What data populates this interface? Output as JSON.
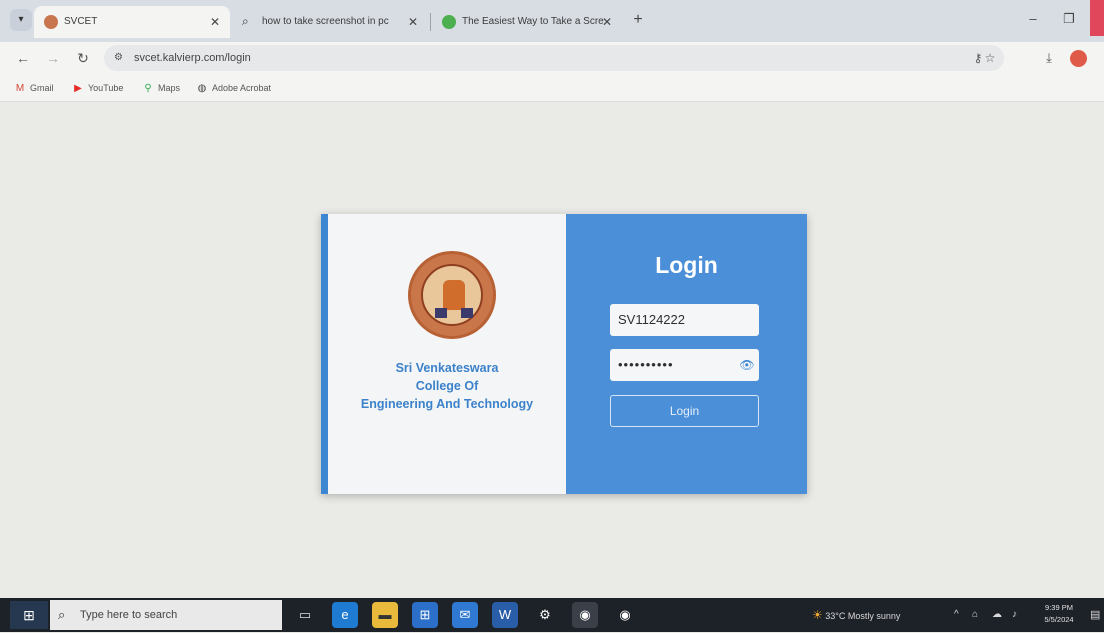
{
  "browser": {
    "tabs": [
      {
        "title": "SVCET",
        "active": true
      },
      {
        "title": "how to take screenshot in pc",
        "active": false
      },
      {
        "title": "The Easiest Way to Take a Scre",
        "active": false
      }
    ],
    "url": "svcet.kalvierp.com/login",
    "bookmarks": [
      "Gmail",
      "YouTube",
      "Maps",
      "Adobe Acrobat"
    ]
  },
  "login_card": {
    "college_name": [
      "Sri Venkateswara",
      "College Of",
      "Engineering And Technology"
    ],
    "title": "Login",
    "username_value": "SV1124222",
    "password_value": "••••••••••",
    "login_button": "Login",
    "accent_color": "#4b8fd8"
  },
  "taskbar": {
    "search_placeholder": "Type here to search",
    "weather_temp": "33°C",
    "weather_text": "Mostly sunny",
    "time": "9:39 PM",
    "date": "5/5/2024"
  }
}
